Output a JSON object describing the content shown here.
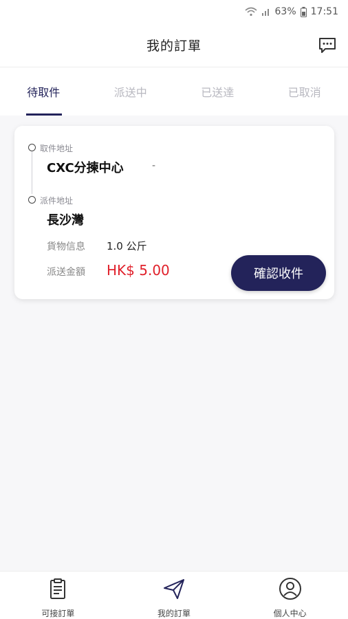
{
  "status_bar": {
    "battery": "63%",
    "time": "17:51"
  },
  "header": {
    "title": "我的訂單"
  },
  "tabs": [
    {
      "label": "待取件",
      "active": true
    },
    {
      "label": "派送中",
      "active": false
    },
    {
      "label": "已送達",
      "active": false
    },
    {
      "label": "已取消",
      "active": false
    }
  ],
  "order": {
    "pickup_label": "取件地址",
    "pickup_place": "CXC分揀中心",
    "pickup_extra": "-",
    "delivery_label": "派件地址",
    "delivery_place": "長沙灣",
    "goods_label": "貨物信息",
    "goods_value": "1.0 公斤",
    "fee_label": "派送金額",
    "fee_value": "HK$ 5.00",
    "confirm_button": "確認收件"
  },
  "bottom_nav": [
    {
      "label": "可接訂單",
      "icon": "clipboard-icon"
    },
    {
      "label": "我的訂單",
      "icon": "send-icon"
    },
    {
      "label": "個人中心",
      "icon": "user-circle-icon"
    }
  ],
  "colors": {
    "primary": "#23235a",
    "price": "#e0202a"
  }
}
